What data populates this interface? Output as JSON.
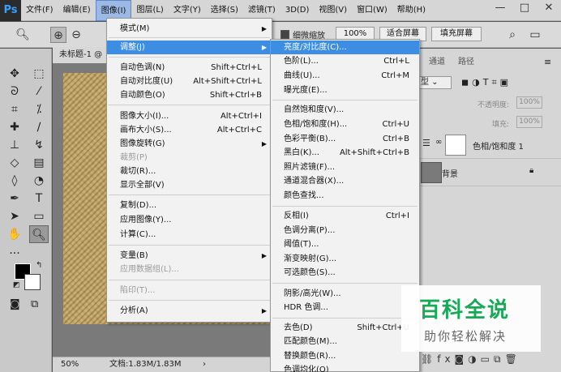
{
  "app": {
    "logo": "Ps"
  },
  "menubar": {
    "items": [
      "文件(F)",
      "编辑(E)",
      "图像(I)",
      "图层(L)",
      "文字(Y)",
      "选择(S)",
      "滤镜(T)",
      "3D(D)",
      "视图(V)",
      "窗口(W)",
      "帮助(H)"
    ],
    "active_index": 2,
    "win_minimize": "—",
    "win_maximize": "□",
    "win_close": "✕"
  },
  "options": {
    "scrubby_zoom": "细微缩放",
    "zoom_value": "100%",
    "fit_screen": "适合屏幕",
    "fill_screen": "填充屏幕"
  },
  "document": {
    "tab_title": "未标题-1 @",
    "zoom": "50%",
    "doc_info": "文档:1.83M/1.83M",
    "arrow": "›"
  },
  "layers_panel": {
    "tabs": [
      "通道",
      "路径"
    ],
    "opacity_label": "不透明度:",
    "opacity_value": "100%",
    "fill_label": "填充:",
    "fill_value": "100%",
    "layers": [
      {
        "name": "色相/饱和度 1"
      },
      {
        "name": "背景"
      }
    ],
    "filter_kind": "型"
  },
  "image_menu": {
    "items": [
      {
        "label": "模式(M)",
        "shortcut": "",
        "submenu": true
      },
      {
        "label": "调整(J)",
        "shortcut": "",
        "submenu": true,
        "highlight": true
      },
      {
        "label": "自动色调(N)",
        "shortcut": "Shift+Ctrl+L"
      },
      {
        "label": "自动对比度(U)",
        "shortcut": "Alt+Shift+Ctrl+L"
      },
      {
        "label": "自动颜色(O)",
        "shortcut": "Shift+Ctrl+B"
      },
      {
        "label": "图像大小(I)...",
        "shortcut": "Alt+Ctrl+I"
      },
      {
        "label": "画布大小(S)...",
        "shortcut": "Alt+Ctrl+C"
      },
      {
        "label": "图像旋转(G)",
        "shortcut": "",
        "submenu": true
      },
      {
        "label": "裁剪(P)",
        "shortcut": "",
        "disabled": true
      },
      {
        "label": "裁切(R)...",
        "shortcut": ""
      },
      {
        "label": "显示全部(V)",
        "shortcut": ""
      },
      {
        "label": "复制(D)...",
        "shortcut": ""
      },
      {
        "label": "应用图像(Y)...",
        "shortcut": ""
      },
      {
        "label": "计算(C)...",
        "shortcut": ""
      },
      {
        "label": "变量(B)",
        "shortcut": "",
        "submenu": true
      },
      {
        "label": "应用数据组(L)...",
        "shortcut": "",
        "disabled": true
      },
      {
        "label": "陷印(T)...",
        "shortcut": "",
        "disabled": true
      },
      {
        "label": "分析(A)",
        "shortcut": "",
        "submenu": true
      }
    ]
  },
  "adjust_menu": {
    "items": [
      {
        "label": "亮度/对比度(C)...",
        "shortcut": "",
        "highlight": true
      },
      {
        "label": "色阶(L)...",
        "shortcut": "Ctrl+L"
      },
      {
        "label": "曲线(U)...",
        "shortcut": "Ctrl+M"
      },
      {
        "label": "曝光度(E)...",
        "shortcut": ""
      },
      {
        "label": "自然饱和度(V)...",
        "shortcut": ""
      },
      {
        "label": "色相/饱和度(H)...",
        "shortcut": "Ctrl+U"
      },
      {
        "label": "色彩平衡(B)...",
        "shortcut": "Ctrl+B"
      },
      {
        "label": "黑白(K)...",
        "shortcut": "Alt+Shift+Ctrl+B"
      },
      {
        "label": "照片滤镜(F)...",
        "shortcut": ""
      },
      {
        "label": "通道混合器(X)...",
        "shortcut": ""
      },
      {
        "label": "颜色查找...",
        "shortcut": ""
      },
      {
        "label": "反相(I)",
        "shortcut": "Ctrl+I"
      },
      {
        "label": "色调分离(P)...",
        "shortcut": ""
      },
      {
        "label": "阈值(T)...",
        "shortcut": ""
      },
      {
        "label": "渐变映射(G)...",
        "shortcut": ""
      },
      {
        "label": "可选颜色(S)...",
        "shortcut": ""
      },
      {
        "label": "阴影/高光(W)...",
        "shortcut": ""
      },
      {
        "label": "HDR 色调...",
        "shortcut": ""
      },
      {
        "label": "去色(D)",
        "shortcut": "Shift+Ctrl+U"
      },
      {
        "label": "匹配颜色(M)...",
        "shortcut": ""
      },
      {
        "label": "替换颜色(R)...",
        "shortcut": ""
      },
      {
        "label": "色调均化(Q)",
        "shortcut": ""
      }
    ]
  },
  "watermark": {
    "title": "百科全说",
    "subtitle": "助你轻松解决"
  },
  "colors": {
    "highlight": "#3d8ee3",
    "watermark_green": "#18a957"
  }
}
